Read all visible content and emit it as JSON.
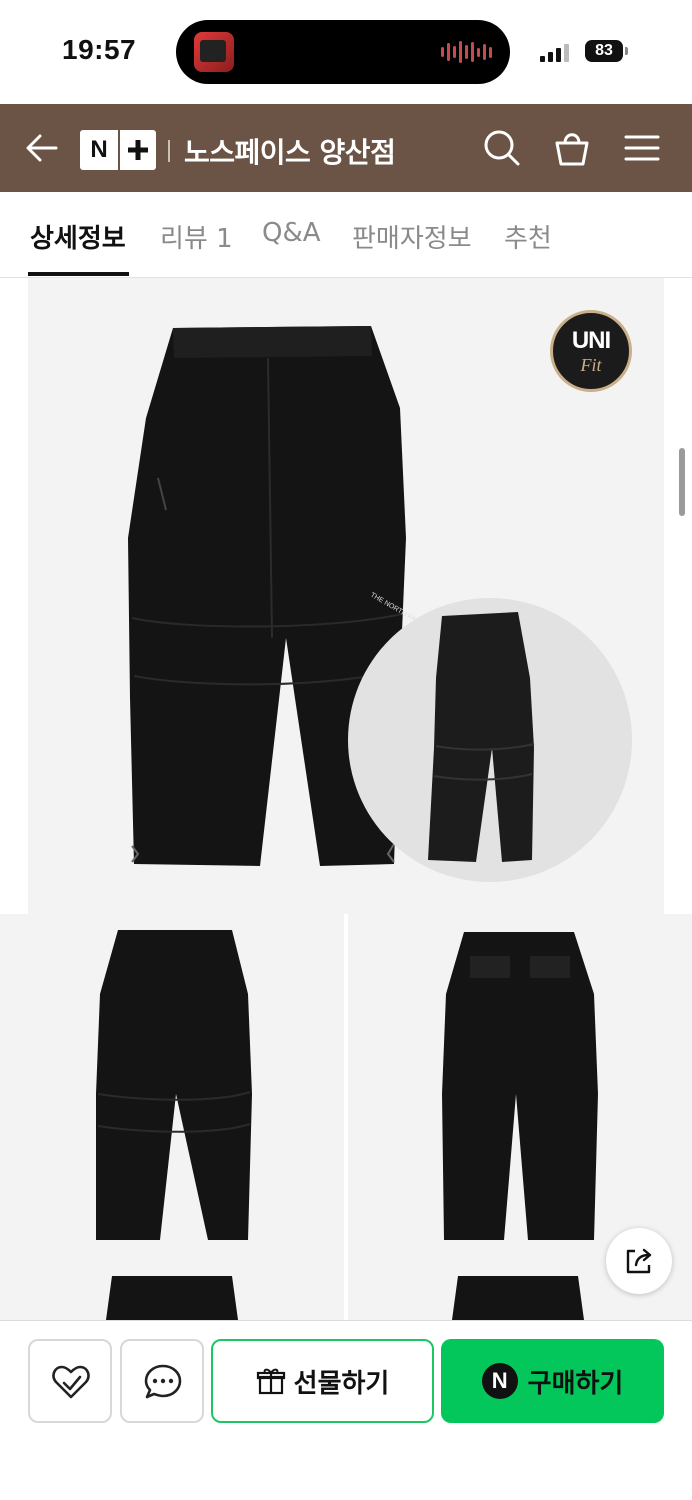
{
  "status_bar": {
    "time": "19:57",
    "battery": "83",
    "icons": [
      "now-playing-thumbnail-icon",
      "audio-waveform-icon",
      "signal-bars-icon",
      "battery-icon"
    ]
  },
  "header": {
    "logo_n": "N",
    "logo_plus": "+",
    "store_title": "노스페이스 양산점",
    "icons": [
      "back-arrow-icon",
      "search-icon",
      "shopping-bag-icon",
      "menu-icon"
    ]
  },
  "tabs": [
    {
      "label": "상세정보",
      "active": true
    },
    {
      "label": "리뷰 1",
      "active": false
    },
    {
      "label": "Q&A",
      "active": false
    },
    {
      "label": "판매자정보",
      "active": false
    },
    {
      "label": "추천",
      "active": false
    }
  ],
  "product": {
    "badge_line1": "UNI",
    "badge_line2": "Fit",
    "images": [
      "front-view",
      "side-view-inset",
      "front-view-small",
      "back-view-small",
      "waist-detail-left",
      "waist-detail-right"
    ]
  },
  "bottom_bar": {
    "gift_label": "선물하기",
    "buy_label": "구매하기",
    "buy_n": "N",
    "icons": [
      "heart-check-icon",
      "chat-bubble-icon",
      "gift-icon",
      "share-icon"
    ]
  },
  "colors": {
    "header_bg": "#6b5445",
    "buy_green": "#03c75a",
    "gift_border": "#1ec764"
  }
}
